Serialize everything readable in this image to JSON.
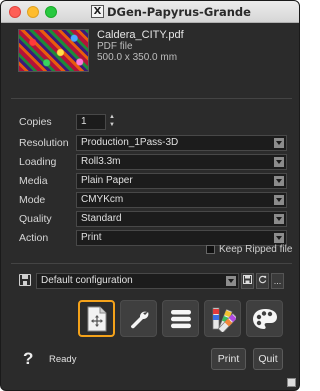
{
  "window": {
    "title": "DGen-Papyrus-Grande",
    "app_icon": "X"
  },
  "file": {
    "name": "Caldera_CITY.pdf",
    "type": "PDF file",
    "size": "500.0 x 350.0 mm"
  },
  "form": {
    "copies": {
      "label": "Copies",
      "value": "1",
      "up": "▲",
      "down": "▼"
    },
    "resolution": {
      "label": "Resolution",
      "value": "Production_1Pass-3D"
    },
    "loading": {
      "label": "Loading",
      "value": "Roll3.3m"
    },
    "media": {
      "label": "Media",
      "value": "Plain Paper"
    },
    "mode": {
      "label": "Mode",
      "value": "CMYKcm"
    },
    "quality": {
      "label": "Quality",
      "value": "Standard"
    },
    "action": {
      "label": "Action",
      "value": "Print"
    },
    "keep_ripped": {
      "label": "Keep Ripped file",
      "checked": false
    }
  },
  "config": {
    "value": "Default configuration",
    "more": "..."
  },
  "tools": [
    {
      "name": "page-layout-tool",
      "icon": "page-move-icon",
      "active": true
    },
    {
      "name": "settings-tool",
      "icon": "wrench-icon",
      "active": false
    },
    {
      "name": "list-tool",
      "icon": "list-icon",
      "active": false
    },
    {
      "name": "swatch-tool",
      "icon": "color-swatch-icon",
      "active": false
    },
    {
      "name": "palette-tool",
      "icon": "palette-icon",
      "active": false
    }
  ],
  "footer": {
    "help": "?",
    "status": "Ready",
    "print_label": "Print",
    "quit_label": "Quit"
  },
  "colors": {
    "accent": "#f4a21a",
    "background": "#2b2b2b"
  }
}
